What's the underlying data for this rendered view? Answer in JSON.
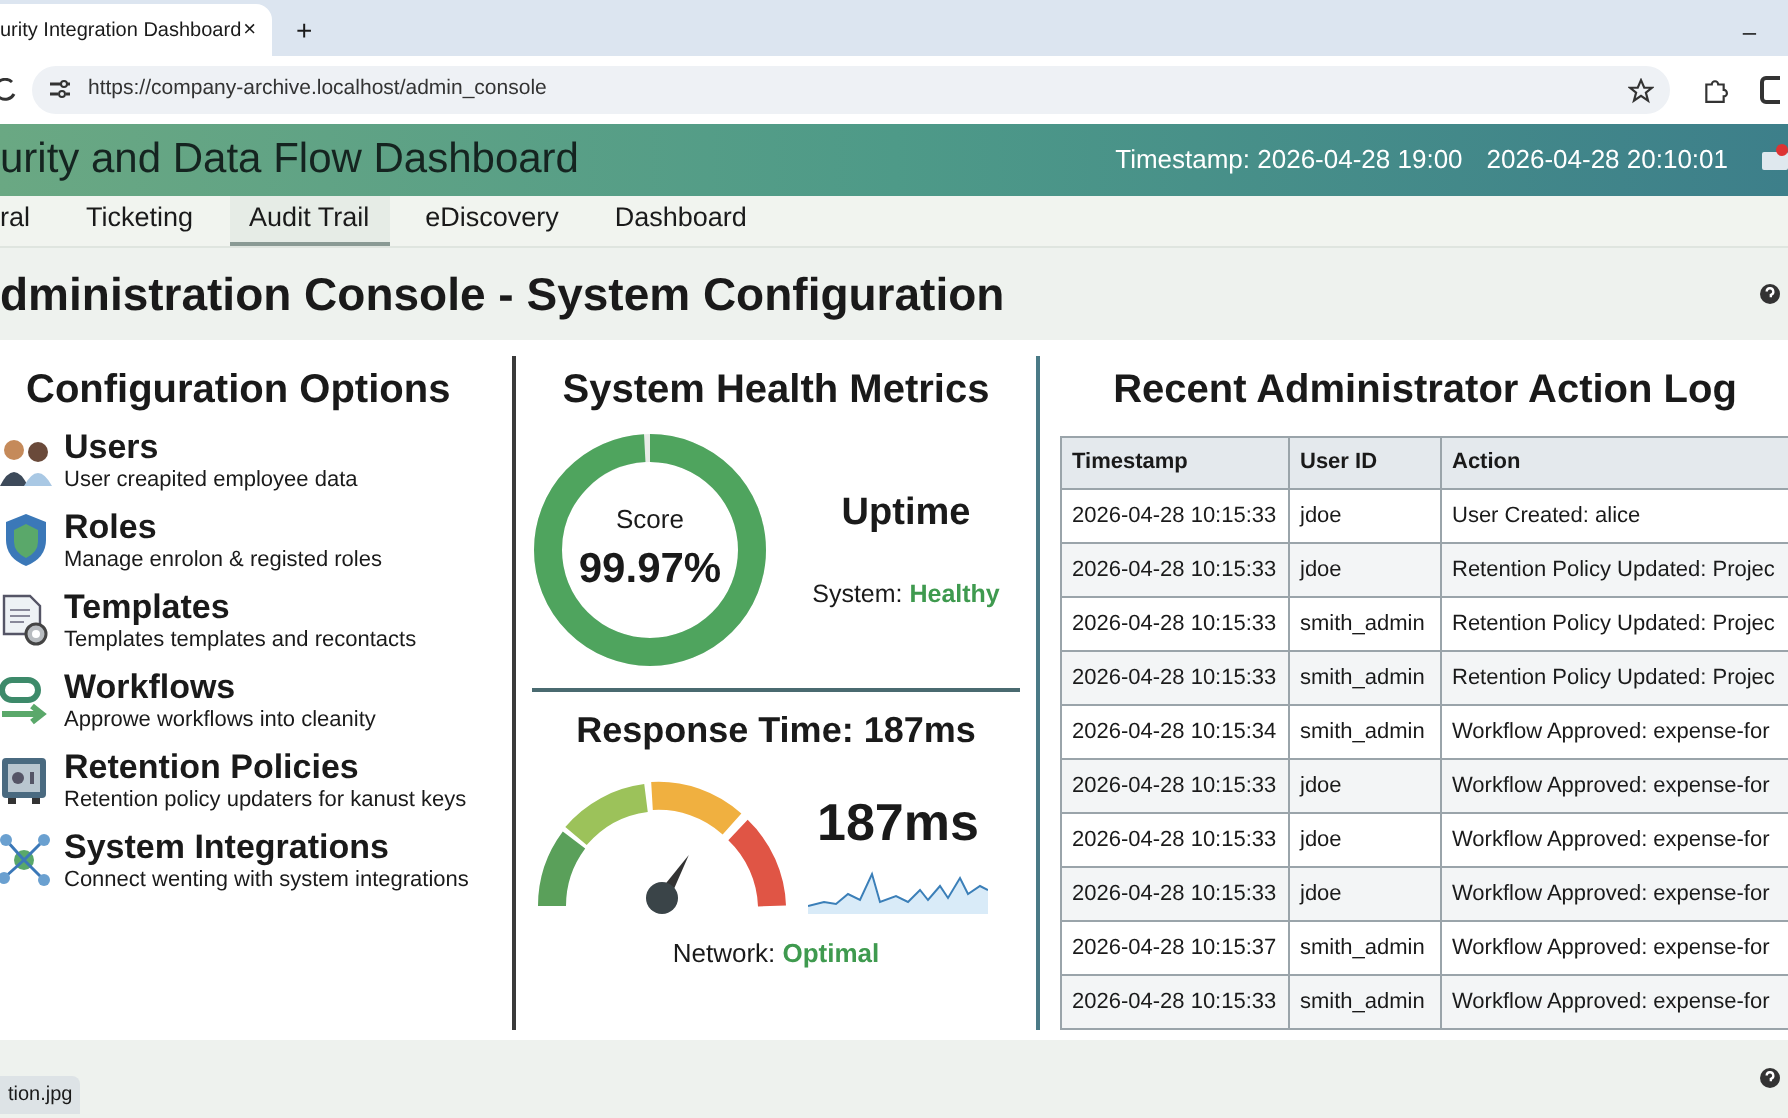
{
  "browser": {
    "tab_title": "urity Integration Dashboard",
    "tab_close": "×",
    "new_tab": "+",
    "minimize": "–",
    "url": "https://company-archive.localhost/admin_console"
  },
  "header": {
    "title": "urity and Data Flow Dashboard",
    "timestamp": "Timestamp: 2026-04-28 19:00",
    "clock": "2026-04-28 20:10:01"
  },
  "nav": [
    {
      "label": "ral",
      "selected": false
    },
    {
      "label": "Ticketing",
      "selected": false
    },
    {
      "label": "Audit Trail",
      "selected": true
    },
    {
      "label": "eDiscovery",
      "selected": false
    },
    {
      "label": "Dashboard",
      "selected": false
    }
  ],
  "page_title": "dministration Console - System Configuration",
  "config": {
    "title": "Configuration Options",
    "items": [
      {
        "kind": "users",
        "name": "Users",
        "description": "User creapited employee data"
      },
      {
        "kind": "roles",
        "name": "Roles",
        "description": "Manage enrolon & registed roles"
      },
      {
        "kind": "templates",
        "name": "Templates",
        "description": "Templates templates and recontacts"
      },
      {
        "kind": "workflows",
        "name": "Workflows",
        "description": "Approwe workflows into cleanity"
      },
      {
        "kind": "retention",
        "name": "Retention Policies",
        "description": "Retention policy updaters for kanust keys"
      },
      {
        "kind": "integrations",
        "name": "System Integrations",
        "description": "Connect wenting with system integrations"
      }
    ]
  },
  "health": {
    "title": "System Health Metrics",
    "score_label": "Score",
    "score": "99.97%",
    "level": 0.99,
    "uptime_title": "Uptime",
    "system_label": "System:",
    "system_status": "Healthy",
    "response_title": "Response Time: 187ms",
    "response_value": "187ms",
    "network_label": "Network:",
    "network_status": "Optimal"
  },
  "log": {
    "title": "Recent Administrator Action Log",
    "columns": [
      "Timestamp",
      "User ID",
      "Action"
    ],
    "rows": [
      [
        "2026-04-28 10:15:33",
        "jdoe",
        "User Created: alice"
      ],
      [
        "2026-04-28 10:15:33",
        "jdoe",
        "Retention Policy Updated: Projec"
      ],
      [
        "2026-04-28 10:15:33",
        "smith_admin",
        "Retention Policy Updated: Projec"
      ],
      [
        "2026-04-28 10:15:33",
        "smith_admin",
        "Retention Policy Updated: Projec"
      ],
      [
        "2026-04-28 10:15:34",
        "smith_admin",
        "Workflow Approved: expense-for"
      ],
      [
        "2026-04-28 10:15:33",
        "jdoe",
        "Workflow Approved: expense-for"
      ],
      [
        "2026-04-28 10:15:33",
        "jdoe",
        "Workflow Approved: expense-for"
      ],
      [
        "2026-04-28 10:15:33",
        "jdoe",
        "Workflow Approved: expense-for"
      ],
      [
        "2026-04-28 10:15:37",
        "smith_admin",
        "Workflow Approved: expense-for"
      ],
      [
        "2026-04-28 10:15:33",
        "smith_admin",
        "Workflow Approved: expense-for"
      ]
    ]
  },
  "download": {
    "filename": "tion.jpg"
  }
}
